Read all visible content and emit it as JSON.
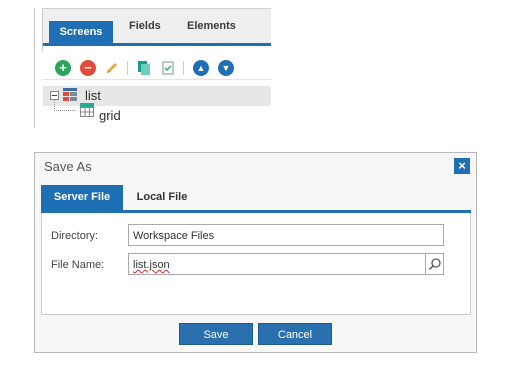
{
  "screens_panel": {
    "tabs": [
      "Screens",
      "Fields",
      "Elements"
    ],
    "toolbar_icons": [
      "add-icon",
      "remove-icon",
      "edit-icon",
      "copy-icon",
      "paste-icon",
      "move-up-icon",
      "move-down-icon"
    ],
    "tree": [
      {
        "label": "list",
        "icon": "table-icon"
      },
      {
        "label": "grid",
        "icon": "grid-icon"
      }
    ]
  },
  "dialog": {
    "title": "Save As",
    "tabs": [
      "Server File",
      "Local File"
    ],
    "directory_label": "Directory:",
    "directory_value": "Workspace Files",
    "filename_label": "File Name:",
    "filename_value": "list.json",
    "save_label": "Save",
    "cancel_label": "Cancel"
  },
  "colors": {
    "accent": "#1f6fb4",
    "button": "#2a6fae"
  }
}
